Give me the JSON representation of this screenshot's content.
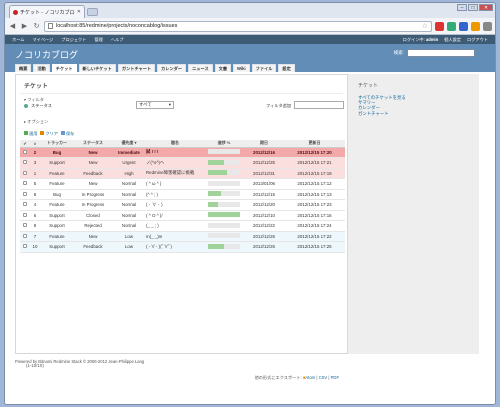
{
  "browser": {
    "tab_title": "チケット - ノコリカブログ - Red",
    "url": "localhost:85/redmine/projects/noconcablog/issues"
  },
  "topmenu": {
    "items": [
      "ホーム",
      "マイページ",
      "プロジェクト",
      "管理",
      "ヘルプ"
    ],
    "login": "ログイン中:",
    "user": "admin",
    "account": "個人設定",
    "logout": "ログアウト"
  },
  "header": {
    "title": "ノコリカブログ",
    "search_label": "検索:"
  },
  "menu": [
    "概要",
    "活動",
    "チケット",
    "新しいチケット",
    "ガントチャート",
    "カレンダー",
    "ニュース",
    "文書",
    "Wiki",
    "ファイル",
    "設定"
  ],
  "main": {
    "title": "チケット",
    "filter_legend": "フィルタ",
    "status_label": "ステータス",
    "status_value": "すべて",
    "filter_add": "フィルタ追加",
    "options": "オプション",
    "apply": "適用",
    "clear": "クリア",
    "save": "保存",
    "count": "(1-10/10)",
    "export_label": "他の形式にエクスポート:",
    "export_atom": "Atom",
    "export_csv": "CSV",
    "export_pdf": "PDF"
  },
  "columns": [
    "#",
    "トラッカー",
    "ステータス",
    "優先度",
    "題名",
    "進捗 %",
    "期日",
    "更新日"
  ],
  "rows": [
    {
      "id": "2",
      "tracker": "Bug",
      "status": "New",
      "priority": "Immediate",
      "subject": "試 ! ! !",
      "progress": 0,
      "due": "2012/12/16",
      "updated": "2012/12/15 17:20",
      "cls": "hi"
    },
    {
      "id": "3",
      "tracker": "Support",
      "status": "New",
      "priority": "Urgent",
      "subject": "ノ(^o^)ヘ",
      "progress": 50,
      "due": "2012/12/25",
      "updated": "2012/12/15 17:21",
      "cls": "pink"
    },
    {
      "id": "1",
      "tracker": "Feature",
      "status": "Feedback",
      "priority": "High",
      "subject": "Redmine障害確認に挑戦",
      "progress": 60,
      "due": "2012/12/31",
      "updated": "2012/12/15 17:19",
      "cls": "pink"
    },
    {
      "id": "5",
      "tracker": "Feature",
      "status": "New",
      "priority": "Normal",
      "subject": "( ^ ω ^ )",
      "progress": 0,
      "due": "2013/01/06",
      "updated": "2012/12/15 17:12",
      "cls": ""
    },
    {
      "id": "8",
      "tracker": "Bug",
      "status": "In Progress",
      "priority": "Normal",
      "subject": "(^ ^ ; )",
      "progress": 40,
      "due": "2012/12/15",
      "updated": "2012/12/15 17:13",
      "cls": ""
    },
    {
      "id": "4",
      "tracker": "Feature",
      "status": "In Progress",
      "priority": "Normal",
      "subject": "( ･ ∀ ･ )",
      "progress": 30,
      "due": "2012/12/20",
      "updated": "2012/12/15 17:23",
      "cls": ""
    },
    {
      "id": "6",
      "tracker": "Support",
      "status": "Closed",
      "priority": "Normal",
      "subject": "( ^ O ^ )/",
      "progress": 100,
      "due": "2012/12/10",
      "updated": "2012/12/15 17:16",
      "cls": ""
    },
    {
      "id": "9",
      "tracker": "Support",
      "status": "Rejected",
      "priority": "Normal",
      "subject": "(_ _ ; )",
      "progress": 0,
      "due": "2012/12/22",
      "updated": "2012/12/15 17:24",
      "cls": ""
    },
    {
      "id": "7",
      "tracker": "Feature",
      "status": "New",
      "priority": "Low",
      "subject": "m(_ _)m",
      "progress": 0,
      "due": "2012/12/26",
      "updated": "2012/12/15 17:22",
      "cls": "lowp"
    },
    {
      "id": "10",
      "tracker": "Support",
      "status": "Feedback",
      "priority": "Low",
      "subject": "( ･∀･ )(ﾟ∀ﾟ)",
      "progress": 50,
      "due": "2012/12/26",
      "updated": "2012/12/15 17:25",
      "cls": "lowp"
    }
  ],
  "sidebar": {
    "title": "チケット",
    "links": [
      "すべてのチケットを見る",
      "サマリー",
      "カレンダー",
      "ガントチャート"
    ]
  },
  "footer": "Powered by Bitnami Redmine Stack © 2006-2012 Jean-Philippe Lang"
}
